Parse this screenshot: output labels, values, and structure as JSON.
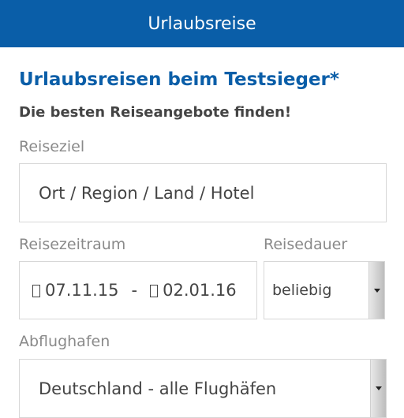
{
  "header": {
    "title": "Urlaubsreise"
  },
  "main": {
    "title": "Urlaubsreisen beim Testsieger*",
    "subtitle": "Die besten Reiseangebote finden!"
  },
  "form": {
    "destination": {
      "label": "Reiseziel",
      "placeholder": "Ort / Region / Land / Hotel"
    },
    "travel_period": {
      "label": "Reisezeitraum",
      "from": "07.11.15",
      "separator": "-",
      "to": "02.01.16",
      "icon": "calendar-icon"
    },
    "duration": {
      "label": "Reisedauer",
      "selected": "beliebig"
    },
    "departure_airport": {
      "label": "Abflughafen",
      "selected": "Deutschland - alle Flughäfen"
    }
  },
  "colors": {
    "header_bg": "#0a5ea8",
    "title": "#0a5ea8",
    "label": "#8a8a8a",
    "text": "#444444",
    "border": "#d7d7d7"
  }
}
